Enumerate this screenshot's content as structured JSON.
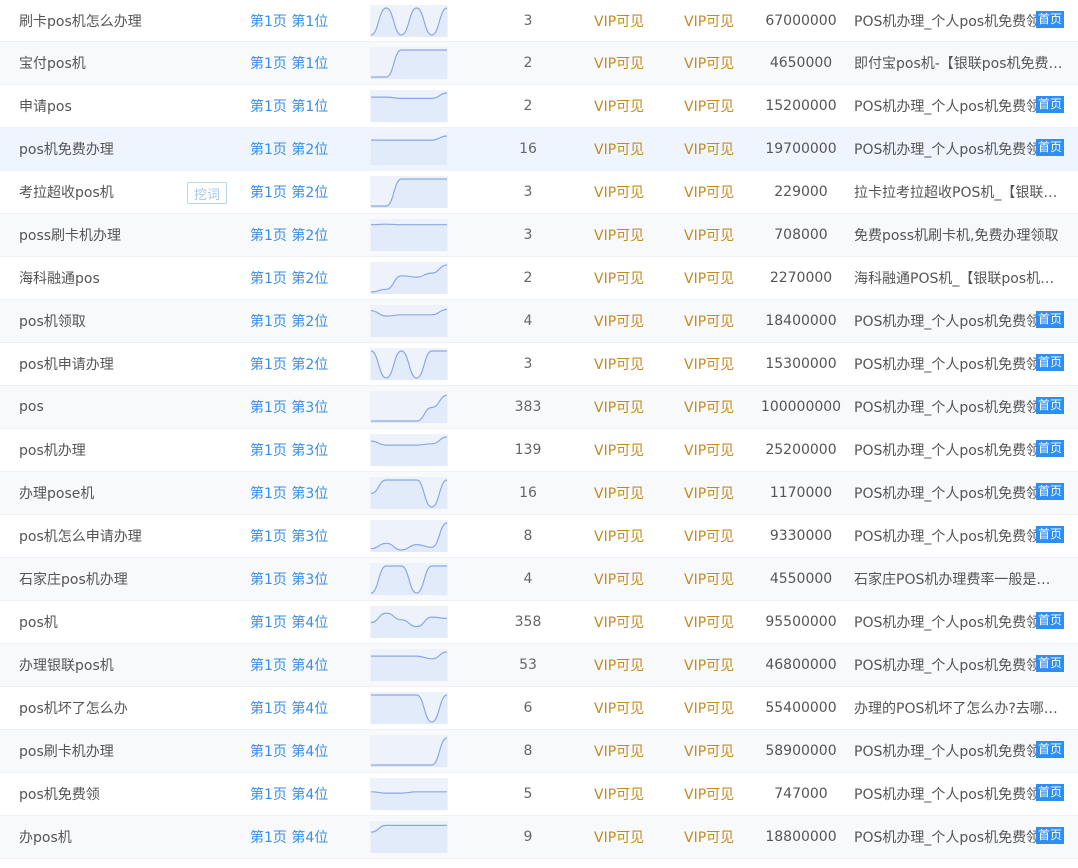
{
  "table": {
    "rows": [
      {
        "keyword": "刷卡pos机怎么办理",
        "rank": "第1页 第1位",
        "trend": [
          0.0,
          1.0,
          0.0,
          1.0,
          0.0,
          1.0
        ],
        "count": "3",
        "vip1": "VIP可见",
        "vip2": "VIP可见",
        "volume": "67000000",
        "title": "POS机办理_个人pos机免费领",
        "badge": "首页"
      },
      {
        "keyword": "宝付pos机",
        "rank": "第1页 第1位",
        "trend": [
          0.0,
          0.0,
          1.0,
          1.0,
          1.0,
          1.0
        ],
        "count": "2",
        "vip1": "VIP可见",
        "vip2": "VIP可见",
        "volume": "4650000",
        "title": "即付宝pos机-【银联pos机免费领取】",
        "badge": ""
      },
      {
        "keyword": "申请pos",
        "rank": "第1页 第1位",
        "trend": [
          0.85,
          0.85,
          0.8,
          0.8,
          0.8,
          1.0
        ],
        "count": "2",
        "vip1": "VIP可见",
        "vip2": "VIP可见",
        "volume": "15200000",
        "title": "POS机办理_个人pos机免费领",
        "badge": "首页"
      },
      {
        "keyword": "pos机免费办理",
        "rank": "第1页 第2位",
        "trend": [
          0.85,
          0.85,
          0.85,
          0.85,
          0.85,
          1.0
        ],
        "count": "16",
        "vip1": "VIP可见",
        "vip2": "VIP可见",
        "volume": "19700000",
        "title": "POS机办理_个人pos机免费领",
        "badge": "首页"
      },
      {
        "keyword": "考拉超收pos机",
        "dig": "挖词",
        "rank": "第1页 第2位",
        "trend": [
          0.0,
          0.0,
          1.0,
          1.0,
          1.0,
          1.0
        ],
        "count": "3",
        "vip1": "VIP可见",
        "vip2": "VIP可见",
        "volume": "229000",
        "title": "拉卡拉考拉超收POS机_【银联pos机免费领取】",
        "badge": ""
      },
      {
        "keyword": "poss刷卡机办理",
        "rank": "第1页 第2位",
        "trend": [
          0.9,
          0.92,
          0.9,
          0.9,
          0.9,
          0.9
        ],
        "count": "3",
        "vip1": "VIP可见",
        "vip2": "VIP可见",
        "volume": "708000",
        "title": "免费poss机刷卡机,免费办理领取",
        "badge": ""
      },
      {
        "keyword": "海科融通pos",
        "rank": "第1页 第2位",
        "trend": [
          0.0,
          0.1,
          0.6,
          0.55,
          0.7,
          1.0
        ],
        "count": "2",
        "vip1": "VIP可见",
        "vip2": "VIP可见",
        "volume": "2270000",
        "title": "海科融通POS机_【银联pos机免费领取】",
        "badge": ""
      },
      {
        "keyword": "pos机领取",
        "rank": "第1页 第2位",
        "trend": [
          0.9,
          0.7,
          0.75,
          0.75,
          0.75,
          0.95
        ],
        "count": "4",
        "vip1": "VIP可见",
        "vip2": "VIP可见",
        "volume": "18400000",
        "title": "POS机办理_个人pos机免费领",
        "badge": "首页"
      },
      {
        "keyword": "pos机申请办理",
        "rank": "第1页 第2位",
        "trend": [
          1.0,
          0.0,
          1.0,
          0.0,
          1.0,
          1.0
        ],
        "count": "3",
        "vip1": "VIP可见",
        "vip2": "VIP可见",
        "volume": "15300000",
        "title": "POS机办理_个人pos机免费领",
        "badge": "首页"
      },
      {
        "keyword": "pos",
        "rank": "第1页 第3位",
        "trend": [
          0.0,
          0.0,
          0.0,
          0.0,
          0.5,
          0.95
        ],
        "count": "383",
        "vip1": "VIP可见",
        "vip2": "VIP可见",
        "volume": "100000000",
        "title": "POS机办理_个人pos机免费领",
        "badge": "首页"
      },
      {
        "keyword": "pos机办理",
        "rank": "第1页 第3位",
        "trend": [
          0.85,
          0.7,
          0.7,
          0.7,
          0.75,
          1.0
        ],
        "count": "139",
        "vip1": "VIP可见",
        "vip2": "VIP可见",
        "volume": "25200000",
        "title": "POS机办理_个人pos机免费领",
        "badge": "首页"
      },
      {
        "keyword": "办理pose机",
        "rank": "第1页 第3位",
        "trend": [
          0.5,
          1.0,
          1.0,
          1.0,
          0.0,
          1.0
        ],
        "count": "16",
        "vip1": "VIP可见",
        "vip2": "VIP可见",
        "volume": "1170000",
        "title": "POS机办理_个人pos机免费领",
        "badge": "首页"
      },
      {
        "keyword": "pos机怎么申请办理",
        "rank": "第1页 第3位",
        "trend": [
          0.05,
          0.25,
          0.0,
          0.2,
          0.1,
          1.0
        ],
        "count": "8",
        "vip1": "VIP可见",
        "vip2": "VIP可见",
        "volume": "9330000",
        "title": "POS机办理_个人pos机免费领",
        "badge": "首页"
      },
      {
        "keyword": "石家庄pos机办理",
        "rank": "第1页 第3位",
        "trend": [
          0.0,
          1.0,
          1.0,
          0.0,
          1.0,
          1.0
        ],
        "count": "4",
        "vip1": "VIP可见",
        "vip2": "VIP可见",
        "volume": "4550000",
        "title": "石家庄POS机办理费率一般是多少",
        "badge": ""
      },
      {
        "keyword": "pos机",
        "rank": "第1页 第4位",
        "trend": [
          0.5,
          0.85,
          0.6,
          0.35,
          0.7,
          0.65
        ],
        "count": "358",
        "vip1": "VIP可见",
        "vip2": "VIP可见",
        "volume": "95500000",
        "title": "POS机办理_个人pos机免费领",
        "badge": "首页"
      },
      {
        "keyword": "办理银联pos机",
        "rank": "第1页 第4位",
        "trend": [
          0.85,
          0.85,
          0.85,
          0.85,
          0.75,
          1.0
        ],
        "count": "53",
        "vip1": "VIP可见",
        "vip2": "VIP可见",
        "volume": "46800000",
        "title": "POS机办理_个人pos机免费领",
        "badge": "首页"
      },
      {
        "keyword": "pos机坏了怎么办",
        "rank": "第1页 第4位",
        "trend": [
          1.0,
          1.0,
          1.0,
          1.0,
          0.0,
          1.0
        ],
        "count": "6",
        "vip1": "VIP可见",
        "vip2": "VIP可见",
        "volume": "55400000",
        "title": "办理的POS机坏了怎么办?去哪里维修",
        "badge": ""
      },
      {
        "keyword": "pos刷卡机办理",
        "rank": "第1页 第4位",
        "trend": [
          0.0,
          0.0,
          0.0,
          0.0,
          0.0,
          1.0
        ],
        "count": "8",
        "vip1": "VIP可见",
        "vip2": "VIP可见",
        "volume": "58900000",
        "title": "POS机办理_个人pos机免费领",
        "badge": "首页"
      },
      {
        "keyword": "pos机免费领",
        "rank": "第1页 第4位",
        "trend": [
          0.6,
          0.55,
          0.55,
          0.6,
          0.6,
          0.6
        ],
        "count": "5",
        "vip1": "VIP可见",
        "vip2": "VIP可见",
        "volume": "747000",
        "title": "POS机办理_个人pos机免费领",
        "badge": "首页"
      },
      {
        "keyword": "办pos机",
        "rank": "第1页 第4位",
        "trend": [
          0.7,
          0.95,
          0.95,
          0.95,
          0.95,
          0.95
        ],
        "count": "9",
        "vip1": "VIP可见",
        "vip2": "VIP可见",
        "volume": "18800000",
        "title": "POS机办理_个人pos机免费领",
        "badge": "首页"
      }
    ]
  }
}
